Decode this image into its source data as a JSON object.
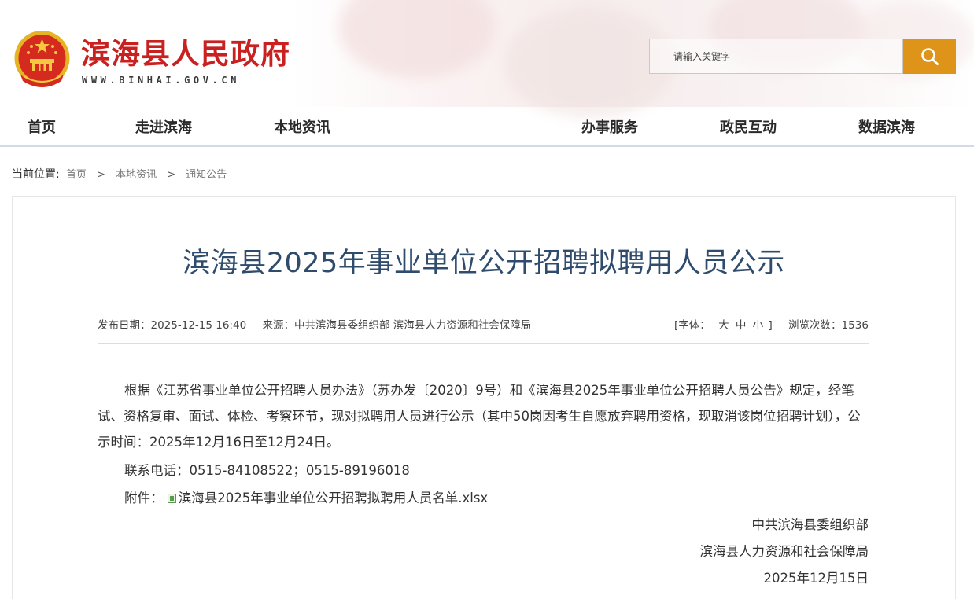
{
  "site": {
    "title": "滨海县人民政府",
    "url": "WWW.BINHAI.GOV.CN"
  },
  "search": {
    "placeholder": "请输入关键字"
  },
  "nav": {
    "items": [
      "首页",
      "走进滨海",
      "本地资讯",
      "办事服务",
      "政民互动",
      "数据滨海"
    ]
  },
  "breadcrumb": {
    "label": "当前位置:",
    "items": [
      "首页",
      "本地资讯",
      "通知公告"
    ],
    "separator": ">"
  },
  "article": {
    "title": "滨海县2025年事业单位公开招聘拟聘用人员公示",
    "date_label": "发布日期：",
    "date": "2025-12-15 16:40",
    "source_label": "来源：",
    "source": "中共滨海县委组织部 滨海县人力资源和社会保障局",
    "font_label_open": "[字体：",
    "font_large": "大",
    "font_medium": "中",
    "font_small": "小",
    "font_label_close": "]",
    "views_label": "浏览次数：",
    "views": "1536",
    "body": "根据《江苏省事业单位公开招聘人员办法》（苏办发〔2020〕9号）和《滨海县2025年事业单位公开招聘人员公告》规定，经笔试、资格复审、面试、体检、考察环节，现对拟聘用人员进行公示（其中50岗因考生自愿放弃聘用资格，现取消该岗位招聘计划），公示时间：2025年12月16日至12月24日。",
    "phone_label": "联系电话：",
    "phone": "0515-84108522；0515-89196018",
    "attachment_label": "附件：",
    "attachment": "滨海县2025年事业单位公开招聘拟聘用人员名单.xlsx",
    "signer_1": "中共滨海县委组织部",
    "signer_2": "滨海县人力资源和社会保障局",
    "sign_date": "2025年12月15日"
  },
  "colors": {
    "title_red": "#c8211f",
    "search_button": "#dd9419",
    "article_title": "#2f4c6d"
  }
}
